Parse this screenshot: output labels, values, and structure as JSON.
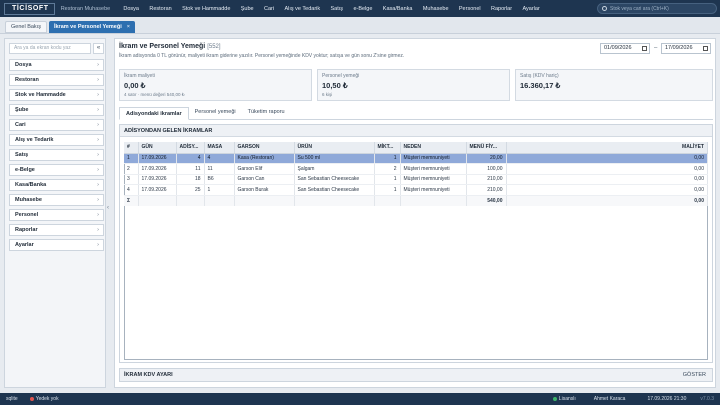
{
  "topbar": {
    "brand": "TİCİSOFT",
    "subtitle": "Restoran Muhasebe",
    "menu": [
      "Dosya",
      "Restoran",
      "Stok ve Hammadde",
      "Şube",
      "Cari",
      "Alış ve Tedarik",
      "Satış",
      "e-Belge",
      "Kasa/Banka",
      "Muhasebe",
      "Personel",
      "Raporlar",
      "Ayarlar"
    ],
    "search_placeholder": "Stok veya cari ara (Ctrl+K)"
  },
  "tabs": [
    {
      "label": "Genel Bakış",
      "active": false
    },
    {
      "label": "İkram ve Personel Yemeği",
      "active": true,
      "close": "×"
    }
  ],
  "sidebar": {
    "search_placeholder": "Ara ya da ekran kodu yaz",
    "collapse_label": "«",
    "items": [
      "Dosya",
      "Restoran",
      "Stok ve Hammadde",
      "Şube",
      "Cari",
      "Alış ve Tedarik",
      "Satış",
      "e-Belge",
      "Kasa/Banka",
      "Muhasebe",
      "Personel",
      "Raporlar",
      "Ayarlar"
    ],
    "chevron": "›",
    "handle": "‹"
  },
  "page": {
    "title": "İkram ve Personel Yemeği",
    "code": "[552]",
    "description": "İkram adisyonda 0 TL görünür, maliyeti ikram giderine yazılır. Personel yemeğinde KDV yoktur; satışa ve gün sonu Z'sine girmez.",
    "date_from": "01/09/2026",
    "date_sep": "–",
    "date_to": "17/09/2026"
  },
  "cards": [
    {
      "label": "İkram maliyeti",
      "value": "0,00 ₺",
      "sub": "4 satır · menü değeri 540,00 ₺"
    },
    {
      "label": "Personel yemeği",
      "value": "10,50 ₺",
      "sub": "6 kişi"
    },
    {
      "label": "Satış (KDV hariç)",
      "value": "16.360,17 ₺",
      "sub": ""
    }
  ],
  "subtabs": [
    "Adisyondaki ikramlar",
    "Personel yemeği",
    "Tüketim raporu"
  ],
  "panel": {
    "title": "ADİSYONDAN GELEN İKRAMLAR",
    "columns": [
      "#",
      "GÜN",
      "ADİSY...",
      "MASA",
      "GARSON",
      "ÜRÜN",
      "MİKT...",
      "NEDEN",
      "MENÜ FİY...",
      "MALİYET"
    ],
    "rows": [
      {
        "no": "1",
        "day": "17.09.2026",
        "adisyon": "4",
        "masa": "4",
        "garson": "Kasa (Restoran)",
        "urun": "Su 500 ml",
        "miktar": "1",
        "neden": "Müşteri memnuniyeti",
        "menu_fiyat": "20,00",
        "maliyet": "0,00",
        "selected": true
      },
      {
        "no": "2",
        "day": "17.09.2026",
        "adisyon": "11",
        "masa": "11",
        "garson": "Garson Elif",
        "urun": "Şalgam",
        "miktar": "2",
        "neden": "Müşteri memnuniyeti",
        "menu_fiyat": "100,00",
        "maliyet": "0,00",
        "selected": false
      },
      {
        "no": "3",
        "day": "17.09.2026",
        "adisyon": "18",
        "masa": "B6",
        "garson": "Garson Can",
        "urun": "San Sebastian Cheesecake",
        "miktar": "1",
        "neden": "Müşteri memnuniyeti",
        "menu_fiyat": "210,00",
        "maliyet": "0,00",
        "selected": false
      },
      {
        "no": "4",
        "day": "17.09.2026",
        "adisyon": "25",
        "masa": "1",
        "garson": "Garson Burak",
        "urun": "San Sebastian Cheesecake",
        "miktar": "1",
        "neden": "Müşteri memnuniyeti",
        "menu_fiyat": "210,00",
        "maliyet": "0,00",
        "selected": false
      }
    ],
    "total": {
      "symbol": "Σ",
      "menu_fiyat": "540,00",
      "maliyet": "0,00"
    }
  },
  "kdv": {
    "title": "İKRAM KDV AYARI",
    "action": "GÖSTER"
  },
  "status": {
    "left": "sqlite",
    "backup": "Yedek yok",
    "license": "Lisanslı",
    "user": "Ahmet Karaca",
    "datetime": "17.09.2026 21:30",
    "version": "v7.0.3"
  },
  "colors": {
    "topbar": "#1e3550",
    "accent": "#2d6fb0",
    "selected_row": "#8fa9d9"
  }
}
